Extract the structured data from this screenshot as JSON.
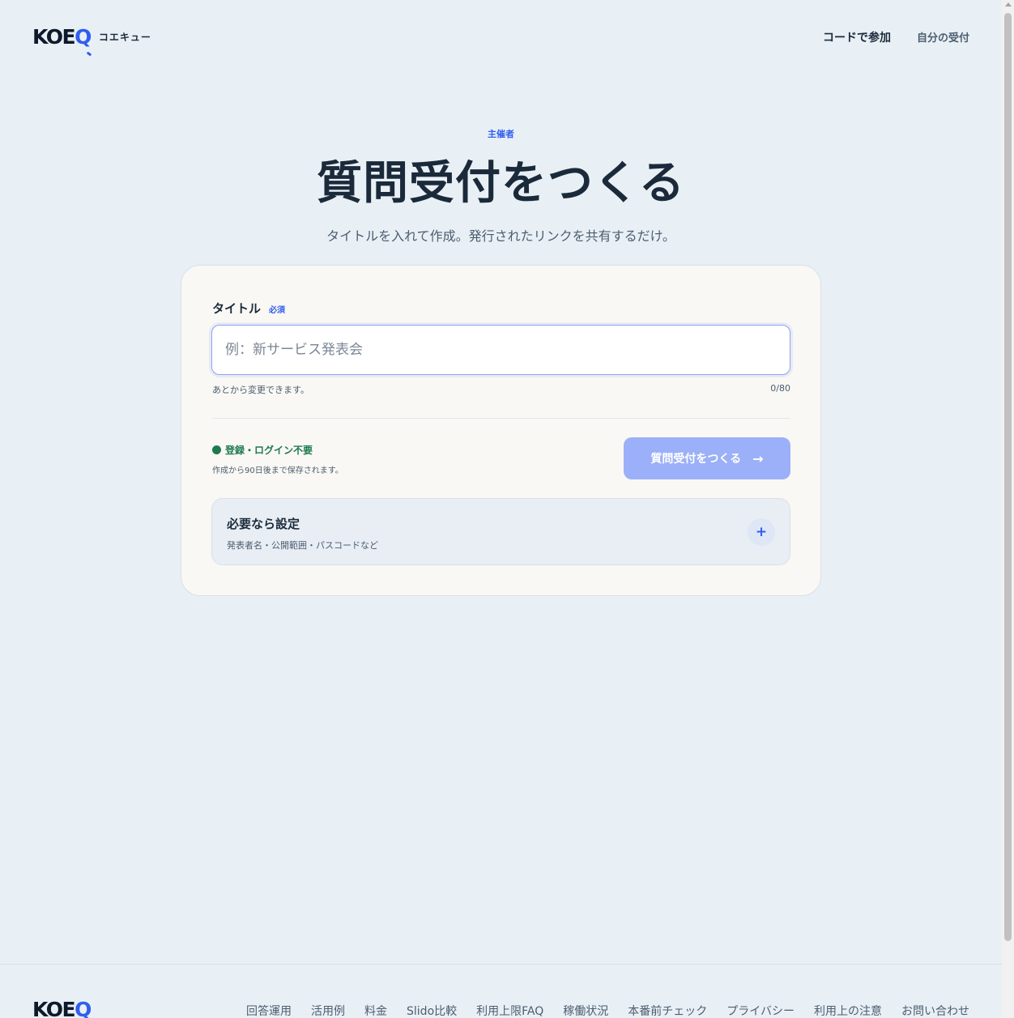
{
  "header": {
    "logo": "KOEQ",
    "logo_main": "KOE",
    "logo_q": "Q",
    "brand_kana": "コエキュー",
    "nav": [
      {
        "label": "コードで参加"
      },
      {
        "label": "自分の受付"
      }
    ]
  },
  "hero": {
    "eyebrow": "主催者",
    "title": "質問受付をつくる",
    "subtitle": "タイトルを入れて作成。発行されたリンクを共有するだけ。"
  },
  "form": {
    "title_label": "タイトル",
    "required_badge": "必須",
    "title_value": "",
    "title_placeholder": "例：新サービス発表会",
    "hint": "あとから変更できます。",
    "char_count": "0/80",
    "free_badge": "登録・ログイン不要",
    "retention_note": "作成から90日後まで保存されます。",
    "submit_label": "質問受付をつくる",
    "submit_arrow": "→",
    "submit_enabled": false
  },
  "settings": {
    "title": "必要なら設定",
    "subtitle": "発表者名・公開範囲・パスコードなど",
    "expand_symbol": "+",
    "expanded": false
  },
  "footer": {
    "logo": "KOEQ",
    "links": [
      {
        "label": "回答運用"
      },
      {
        "label": "活用例"
      },
      {
        "label": "料金"
      },
      {
        "label": "Slido比較"
      },
      {
        "label": "利用上限FAQ"
      },
      {
        "label": "稼働状況"
      },
      {
        "label": "本番前チェック"
      },
      {
        "label": "プライバシー"
      },
      {
        "label": "利用上の注意"
      },
      {
        "label": "お問い合わせ"
      }
    ]
  },
  "colors": {
    "accent": "#2f5ef0",
    "background": "#e9f0f5",
    "card": "#faf8f4",
    "success": "#1d7a4f",
    "button_disabled": "#9bb0f8"
  },
  "icons": {
    "status_dot": "green-dot-icon",
    "arrow": "arrow-right-icon",
    "expand": "plus-icon"
  }
}
